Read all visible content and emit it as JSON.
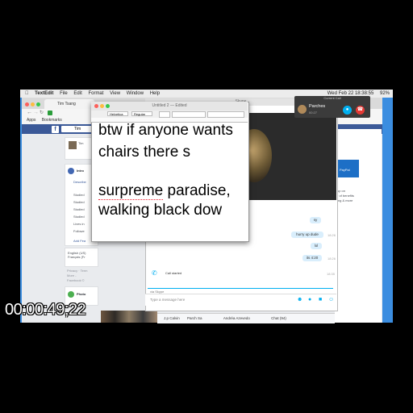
{
  "menubar": {
    "app": "TextEdit",
    "items": [
      "File",
      "Edit",
      "Format",
      "View",
      "Window",
      "Help"
    ],
    "clock": "Wed Feb 22  18:38:55",
    "battery": "92%"
  },
  "browser": {
    "tab_title": "Tim Tsang",
    "bookmarks": [
      "Apps",
      "Bookmarks"
    ]
  },
  "facebook": {
    "search_text": "Tim",
    "profile_name": "Tim",
    "intro_title": "Intro",
    "intro_describe": "Describe",
    "intro_items": [
      "Studied",
      "Studied",
      "Studied",
      "Studied",
      "Lives in",
      "Followe"
    ],
    "add_featured": "Add Fea",
    "lang": "English (US)\nFrançais (Fr",
    "footer": "Privacy · Term\nMore -\nFacebook ©",
    "photos_label": "Photo",
    "right_text": [
      "up on",
      "r of benefits",
      "ing & more"
    ],
    "paypal_label": "PayPal"
  },
  "textedit": {
    "title": "Untitled 2 — Edited",
    "font": "Helvetica",
    "style": "Regular",
    "lines": [
      "btw if anyone wants",
      "chairs there s",
      "",
      "surpreme paradise,",
      "walking black dow"
    ]
  },
  "skype": {
    "title": "Skype",
    "messages": [
      {
        "text": "sy",
        "time": ""
      },
      {
        "text": "hurry up dude",
        "time": "18:26"
      },
      {
        "text": "lol",
        "time": ""
      },
      {
        "text": "its 4:20",
        "time": "18:26"
      }
    ],
    "call_started": "Call started",
    "call_time": "18:35",
    "via": "via Skype",
    "input_placeholder": "Type a message here"
  },
  "call": {
    "header": "Current Call",
    "name": "Parches",
    "sub": "00:27"
  },
  "chatbar": {
    "items": [
      "J.p Calvin",
      "Parch Sa",
      "Andréa Azevedo",
      "Chat (94)"
    ]
  },
  "timecode": "00:00:49;22"
}
